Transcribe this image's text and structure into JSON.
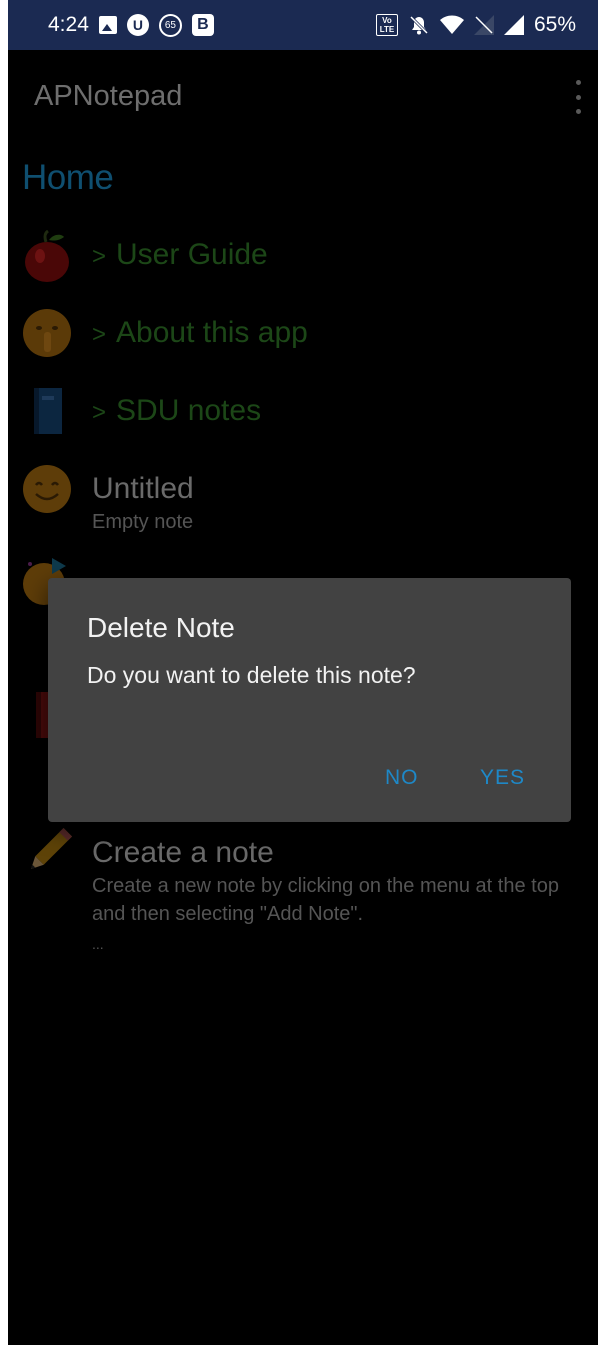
{
  "status_bar": {
    "time": "4:24",
    "left_icons": [
      "image-icon",
      "u-notification-icon",
      "65-notification-icon",
      "b-notification-icon"
    ],
    "right_icons": [
      "volte-icon",
      "bell-off-icon",
      "wifi-icon",
      "no-sim-icon",
      "signal-icon"
    ],
    "battery": "65%"
  },
  "app_bar": {
    "title": "APNotepad",
    "overflow_icon": "more-vert-icon"
  },
  "home_title": "Home",
  "notes": [
    {
      "icon": "apple-icon",
      "title": "User Guide",
      "type": "folder"
    },
    {
      "icon": "shushing-face-icon",
      "title": "About this app",
      "type": "folder"
    },
    {
      "icon": "blue-book-icon",
      "title": "SDU notes",
      "type": "folder"
    },
    {
      "icon": "smiling-face-icon",
      "title": "Untitled",
      "subtitle": "Empty note",
      "type": "note"
    },
    {
      "icon": "party-face-icon",
      "type": "note"
    },
    {
      "icon": "red-book-icon",
      "type": "note"
    },
    {
      "icon": "pencil-icon",
      "title": "Create a note",
      "subtitle": "Create a new note by clicking on the menu at the top and then selecting \"Add Note\".",
      "extra": "...",
      "type": "note"
    }
  ],
  "dialog": {
    "title": "Delete Note",
    "message": "Do you want to delete this note?",
    "no_label": "NO",
    "yes_label": "YES"
  },
  "colors": {
    "status_bar_bg": "#1b2a52",
    "home_title": "#0f4f70",
    "folder_text": "#1c4717",
    "dialog_bg": "#424242",
    "dialog_button": "#1e88c7"
  }
}
